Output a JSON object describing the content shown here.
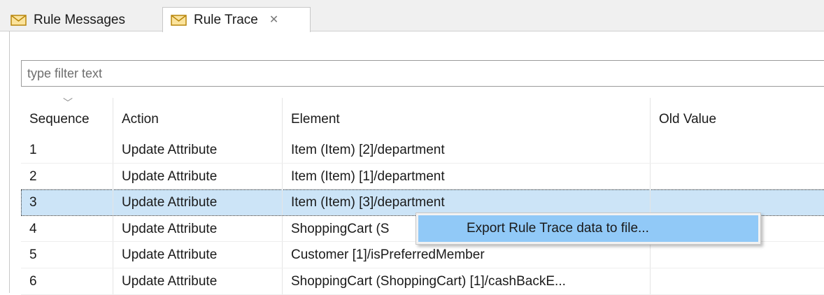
{
  "tabs": [
    {
      "label": "Rule Messages",
      "icon": "envelope-icon"
    },
    {
      "label": "Rule Trace",
      "icon": "envelope-icon",
      "close_icon": "close-icon"
    }
  ],
  "filter": {
    "placeholder": "type filter text",
    "value": ""
  },
  "table": {
    "columns": [
      "Sequence",
      "Action",
      "Element",
      "Old Value"
    ],
    "sort_icon": "chevron-down-icon",
    "rows": [
      {
        "seq": "1",
        "action": "Update Attribute",
        "element": "Item (Item) [2]/department",
        "old": ""
      },
      {
        "seq": "2",
        "action": "Update Attribute",
        "element": "Item (Item) [1]/department",
        "old": ""
      },
      {
        "seq": "3",
        "action": "Update Attribute",
        "element": "Item (Item) [3]/department",
        "old": ""
      },
      {
        "seq": "4",
        "action": "Update Attribute",
        "element": "ShoppingCart (S",
        "old": ""
      },
      {
        "seq": "5",
        "action": "Update Attribute",
        "element": "Customer [1]/isPreferredMember",
        "old": ""
      },
      {
        "seq": "6",
        "action": "Update Attribute",
        "element": "ShoppingCart (ShoppingCart) [1]/cashBackE...",
        "old": ""
      }
    ],
    "selected_row": 3
  },
  "context_menu": {
    "items": [
      {
        "label": "Export Rule Trace data to file..."
      }
    ]
  },
  "colors": {
    "selection": "#cce4f7",
    "menu_highlight": "#91c9f7"
  }
}
